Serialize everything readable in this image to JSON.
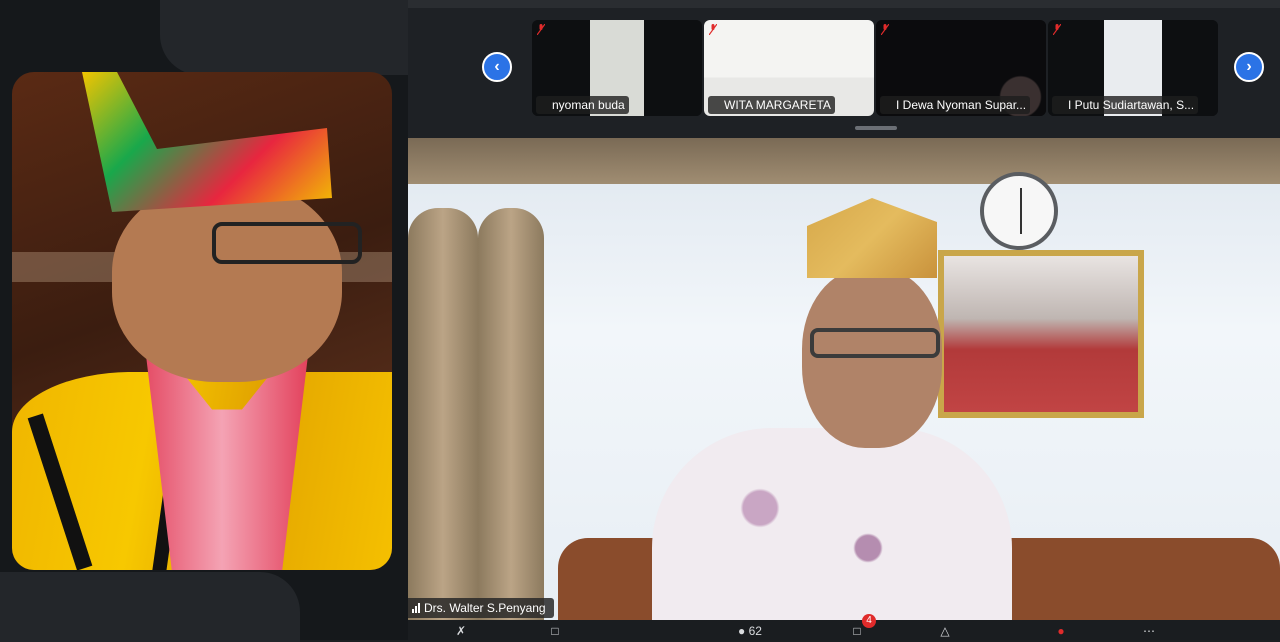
{
  "participants": [
    {
      "name": "nyoman buda"
    },
    {
      "name": "WITA MARGARETA"
    },
    {
      "name": "I Dewa Nyoman Supar..."
    },
    {
      "name": "I Putu Sudiartawan, S..."
    }
  ],
  "main_speaker": {
    "name": "Drs. Walter S.Penyang"
  },
  "toolbar": {
    "participants_count": "62",
    "chat_badge": "4"
  },
  "icons": {
    "prev": "chevron-left-icon",
    "next": "chevron-right-icon",
    "muted": "mic-muted-icon",
    "signal": "signal-bars-icon"
  },
  "colors": {
    "nav_blue": "#2b73e6",
    "muted_red": "#e02b2b",
    "badge_red": "#e02b2b"
  }
}
